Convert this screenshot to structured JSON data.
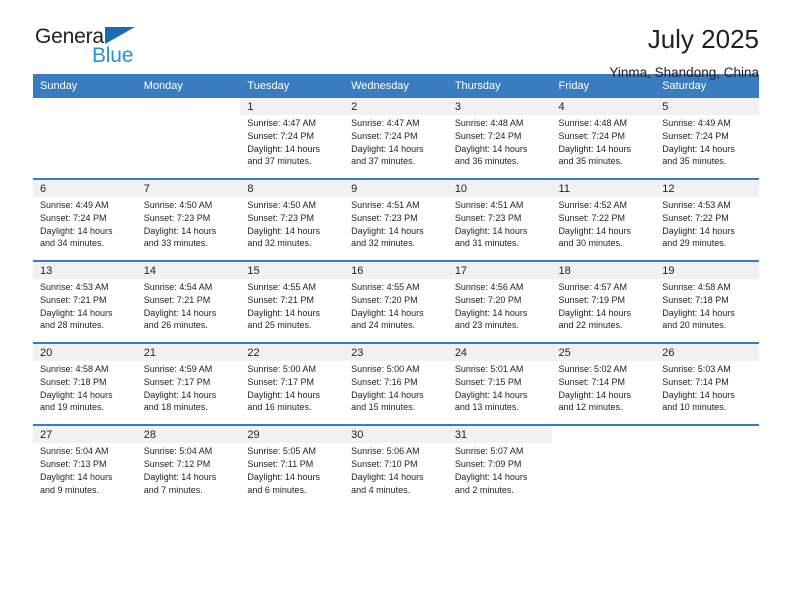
{
  "brand": {
    "name_part1": "General",
    "name_part2": "Blue",
    "flag_icon": "blue-flag-triangle",
    "colors": {
      "dark": "#231f20",
      "blue": "#2b8fd4",
      "flag": "#1b6cb5"
    }
  },
  "header": {
    "title": "July 2025",
    "subtitle": "Yinma, Shandong, China"
  },
  "theme": {
    "header_blue": "#3a7cc0",
    "daynum_bg": "#f1f1f1",
    "text": "#231f20"
  },
  "columns": [
    "Sunday",
    "Monday",
    "Tuesday",
    "Wednesday",
    "Thursday",
    "Friday",
    "Saturday"
  ],
  "weeks": [
    [
      {
        "day": "",
        "empty": true
      },
      {
        "day": "",
        "empty": true
      },
      {
        "day": "1",
        "sunrise": "Sunrise: 4:47 AM",
        "sunset": "Sunset: 7:24 PM",
        "daylight1": "Daylight: 14 hours",
        "daylight2": "and 37 minutes."
      },
      {
        "day": "2",
        "sunrise": "Sunrise: 4:47 AM",
        "sunset": "Sunset: 7:24 PM",
        "daylight1": "Daylight: 14 hours",
        "daylight2": "and 37 minutes."
      },
      {
        "day": "3",
        "sunrise": "Sunrise: 4:48 AM",
        "sunset": "Sunset: 7:24 PM",
        "daylight1": "Daylight: 14 hours",
        "daylight2": "and 36 minutes."
      },
      {
        "day": "4",
        "sunrise": "Sunrise: 4:48 AM",
        "sunset": "Sunset: 7:24 PM",
        "daylight1": "Daylight: 14 hours",
        "daylight2": "and 35 minutes."
      },
      {
        "day": "5",
        "sunrise": "Sunrise: 4:49 AM",
        "sunset": "Sunset: 7:24 PM",
        "daylight1": "Daylight: 14 hours",
        "daylight2": "and 35 minutes."
      }
    ],
    [
      {
        "day": "6",
        "sunrise": "Sunrise: 4:49 AM",
        "sunset": "Sunset: 7:24 PM",
        "daylight1": "Daylight: 14 hours",
        "daylight2": "and 34 minutes."
      },
      {
        "day": "7",
        "sunrise": "Sunrise: 4:50 AM",
        "sunset": "Sunset: 7:23 PM",
        "daylight1": "Daylight: 14 hours",
        "daylight2": "and 33 minutes."
      },
      {
        "day": "8",
        "sunrise": "Sunrise: 4:50 AM",
        "sunset": "Sunset: 7:23 PM",
        "daylight1": "Daylight: 14 hours",
        "daylight2": "and 32 minutes."
      },
      {
        "day": "9",
        "sunrise": "Sunrise: 4:51 AM",
        "sunset": "Sunset: 7:23 PM",
        "daylight1": "Daylight: 14 hours",
        "daylight2": "and 32 minutes."
      },
      {
        "day": "10",
        "sunrise": "Sunrise: 4:51 AM",
        "sunset": "Sunset: 7:23 PM",
        "daylight1": "Daylight: 14 hours",
        "daylight2": "and 31 minutes."
      },
      {
        "day": "11",
        "sunrise": "Sunrise: 4:52 AM",
        "sunset": "Sunset: 7:22 PM",
        "daylight1": "Daylight: 14 hours",
        "daylight2": "and 30 minutes."
      },
      {
        "day": "12",
        "sunrise": "Sunrise: 4:53 AM",
        "sunset": "Sunset: 7:22 PM",
        "daylight1": "Daylight: 14 hours",
        "daylight2": "and 29 minutes."
      }
    ],
    [
      {
        "day": "13",
        "sunrise": "Sunrise: 4:53 AM",
        "sunset": "Sunset: 7:21 PM",
        "daylight1": "Daylight: 14 hours",
        "daylight2": "and 28 minutes."
      },
      {
        "day": "14",
        "sunrise": "Sunrise: 4:54 AM",
        "sunset": "Sunset: 7:21 PM",
        "daylight1": "Daylight: 14 hours",
        "daylight2": "and 26 minutes."
      },
      {
        "day": "15",
        "sunrise": "Sunrise: 4:55 AM",
        "sunset": "Sunset: 7:21 PM",
        "daylight1": "Daylight: 14 hours",
        "daylight2": "and 25 minutes."
      },
      {
        "day": "16",
        "sunrise": "Sunrise: 4:55 AM",
        "sunset": "Sunset: 7:20 PM",
        "daylight1": "Daylight: 14 hours",
        "daylight2": "and 24 minutes."
      },
      {
        "day": "17",
        "sunrise": "Sunrise: 4:56 AM",
        "sunset": "Sunset: 7:20 PM",
        "daylight1": "Daylight: 14 hours",
        "daylight2": "and 23 minutes."
      },
      {
        "day": "18",
        "sunrise": "Sunrise: 4:57 AM",
        "sunset": "Sunset: 7:19 PM",
        "daylight1": "Daylight: 14 hours",
        "daylight2": "and 22 minutes."
      },
      {
        "day": "19",
        "sunrise": "Sunrise: 4:58 AM",
        "sunset": "Sunset: 7:18 PM",
        "daylight1": "Daylight: 14 hours",
        "daylight2": "and 20 minutes."
      }
    ],
    [
      {
        "day": "20",
        "sunrise": "Sunrise: 4:58 AM",
        "sunset": "Sunset: 7:18 PM",
        "daylight1": "Daylight: 14 hours",
        "daylight2": "and 19 minutes."
      },
      {
        "day": "21",
        "sunrise": "Sunrise: 4:59 AM",
        "sunset": "Sunset: 7:17 PM",
        "daylight1": "Daylight: 14 hours",
        "daylight2": "and 18 minutes."
      },
      {
        "day": "22",
        "sunrise": "Sunrise: 5:00 AM",
        "sunset": "Sunset: 7:17 PM",
        "daylight1": "Daylight: 14 hours",
        "daylight2": "and 16 minutes."
      },
      {
        "day": "23",
        "sunrise": "Sunrise: 5:00 AM",
        "sunset": "Sunset: 7:16 PM",
        "daylight1": "Daylight: 14 hours",
        "daylight2": "and 15 minutes."
      },
      {
        "day": "24",
        "sunrise": "Sunrise: 5:01 AM",
        "sunset": "Sunset: 7:15 PM",
        "daylight1": "Daylight: 14 hours",
        "daylight2": "and 13 minutes."
      },
      {
        "day": "25",
        "sunrise": "Sunrise: 5:02 AM",
        "sunset": "Sunset: 7:14 PM",
        "daylight1": "Daylight: 14 hours",
        "daylight2": "and 12 minutes."
      },
      {
        "day": "26",
        "sunrise": "Sunrise: 5:03 AM",
        "sunset": "Sunset: 7:14 PM",
        "daylight1": "Daylight: 14 hours",
        "daylight2": "and 10 minutes."
      }
    ],
    [
      {
        "day": "27",
        "sunrise": "Sunrise: 5:04 AM",
        "sunset": "Sunset: 7:13 PM",
        "daylight1": "Daylight: 14 hours",
        "daylight2": "and 9 minutes."
      },
      {
        "day": "28",
        "sunrise": "Sunrise: 5:04 AM",
        "sunset": "Sunset: 7:12 PM",
        "daylight1": "Daylight: 14 hours",
        "daylight2": "and 7 minutes."
      },
      {
        "day": "29",
        "sunrise": "Sunrise: 5:05 AM",
        "sunset": "Sunset: 7:11 PM",
        "daylight1": "Daylight: 14 hours",
        "daylight2": "and 6 minutes."
      },
      {
        "day": "30",
        "sunrise": "Sunrise: 5:06 AM",
        "sunset": "Sunset: 7:10 PM",
        "daylight1": "Daylight: 14 hours",
        "daylight2": "and 4 minutes."
      },
      {
        "day": "31",
        "sunrise": "Sunrise: 5:07 AM",
        "sunset": "Sunset: 7:09 PM",
        "daylight1": "Daylight: 14 hours",
        "daylight2": "and 2 minutes."
      },
      {
        "day": "",
        "empty": true
      },
      {
        "day": "",
        "empty": true
      }
    ]
  ]
}
